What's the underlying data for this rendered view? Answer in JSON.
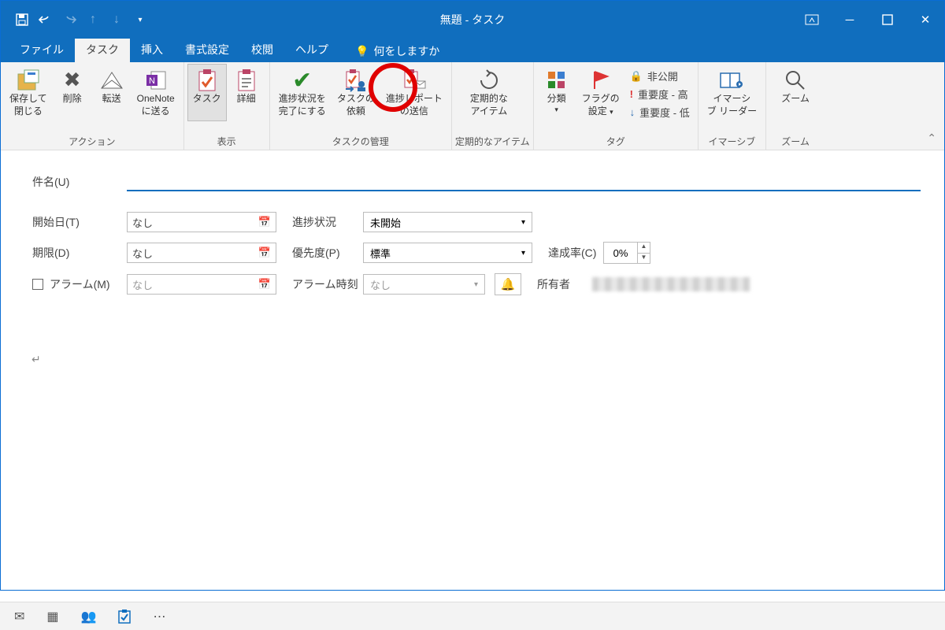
{
  "title": "無題 - タスク",
  "qat": {
    "save": "save-icon",
    "undo": "undo-icon",
    "redo": "redo-icon",
    "up": "up-icon",
    "down": "down-icon"
  },
  "menu": {
    "file": "ファイル",
    "task": "タスク",
    "insert": "挿入",
    "format": "書式設定",
    "review": "校閲",
    "help": "ヘルプ",
    "tellme": "何をしますか"
  },
  "ribbon": {
    "actions": {
      "label": "アクション",
      "save_close1": "保存して",
      "save_close2": "閉じる",
      "delete": "削除",
      "forward": "転送",
      "onenote1": "OneNote",
      "onenote2": "に送る"
    },
    "show": {
      "label": "表示",
      "task": "タスク",
      "details": "詳細"
    },
    "manage": {
      "label": "タスクの管理",
      "complete1": "進捗状況を",
      "complete2": "完了にする",
      "assign1": "タスクの",
      "assign2": "依頼",
      "report1": "進捗レポート",
      "report2": "の送信"
    },
    "recur": {
      "label": "定期的なアイテム",
      "item1": "定期的な",
      "item2": "アイテム"
    },
    "tags": {
      "label": "タグ",
      "categorize": "分類",
      "followup1": "フラグの",
      "followup2": "設定",
      "private": "非公開",
      "imp_high": "重要度 - 高",
      "imp_low": "重要度 - 低"
    },
    "immersive": {
      "label": "イマーシブ",
      "reader1": "イマーシ",
      "reader2": "ブ リーダー"
    },
    "zoom": {
      "label": "ズーム",
      "btn": "ズーム"
    }
  },
  "form": {
    "subject_label": "件名(U)",
    "start_label": "開始日(T)",
    "start_val": "なし",
    "due_label": "期限(D)",
    "due_val": "なし",
    "status_label": "進捗状況",
    "status_val": "未開始",
    "priority_label": "優先度(P)",
    "priority_val": "標準",
    "complete_label": "達成率(C)",
    "complete_val": "0%",
    "alarm_label": "アラーム(M)",
    "alarm_date": "なし",
    "alarm_time_label": "アラーム時刻",
    "alarm_time_val": "なし",
    "owner_label": "所有者"
  },
  "body_marker": "↵",
  "navbar": {
    "mail": "mail-icon",
    "calendar": "calendar-icon",
    "people": "people-icon",
    "tasks": "tasks-icon",
    "more": "⋯"
  }
}
